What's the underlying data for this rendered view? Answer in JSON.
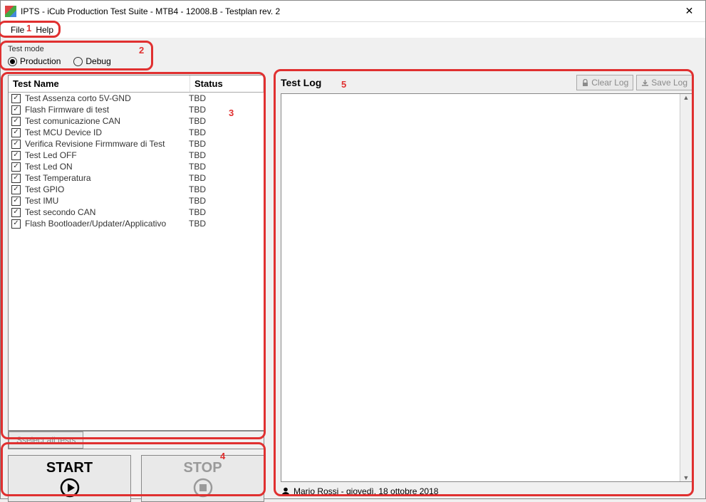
{
  "window": {
    "title": "IPTS - iCub Production Test Suite -  MTB4 - 12008.B - Testplan rev. 2"
  },
  "menubar": {
    "file": "File",
    "help": "Help"
  },
  "annotations": {
    "n1": "1",
    "n2": "2",
    "n3": "3",
    "n4": "4",
    "n5": "5"
  },
  "test_mode": {
    "label": "Test mode",
    "production": "Production",
    "debug": "Debug",
    "selected": "production"
  },
  "test_table": {
    "head_name": "Test Name",
    "head_status": "Status",
    "rows": [
      {
        "name": "Test Assenza corto 5V-GND",
        "status": "TBD"
      },
      {
        "name": "Flash Firmware di test",
        "status": "TBD"
      },
      {
        "name": "Test comunicazione CAN",
        "status": "TBD"
      },
      {
        "name": "Test MCU Device ID",
        "status": "TBD"
      },
      {
        "name": "Verifica Revisione Firmmware di Test",
        "status": "TBD"
      },
      {
        "name": "Test Led OFF",
        "status": "TBD"
      },
      {
        "name": "Test Led ON",
        "status": "TBD"
      },
      {
        "name": "Test Temperatura",
        "status": "TBD"
      },
      {
        "name": "Test GPIO",
        "status": "TBD"
      },
      {
        "name": "Test IMU",
        "status": "TBD"
      },
      {
        "name": "Test secondo CAN",
        "status": "TBD"
      },
      {
        "name": "Flash Bootloader/Updater/Applicativo",
        "status": "TBD"
      }
    ],
    "select_all": "Sselect all tests"
  },
  "buttons": {
    "start": "START",
    "stop": "STOP"
  },
  "log": {
    "title": "Test Log",
    "clear": "Clear Log",
    "save": "Save Log"
  },
  "status_bar": {
    "text": "Mario Rossi - giovedì, 18 ottobre 2018"
  }
}
